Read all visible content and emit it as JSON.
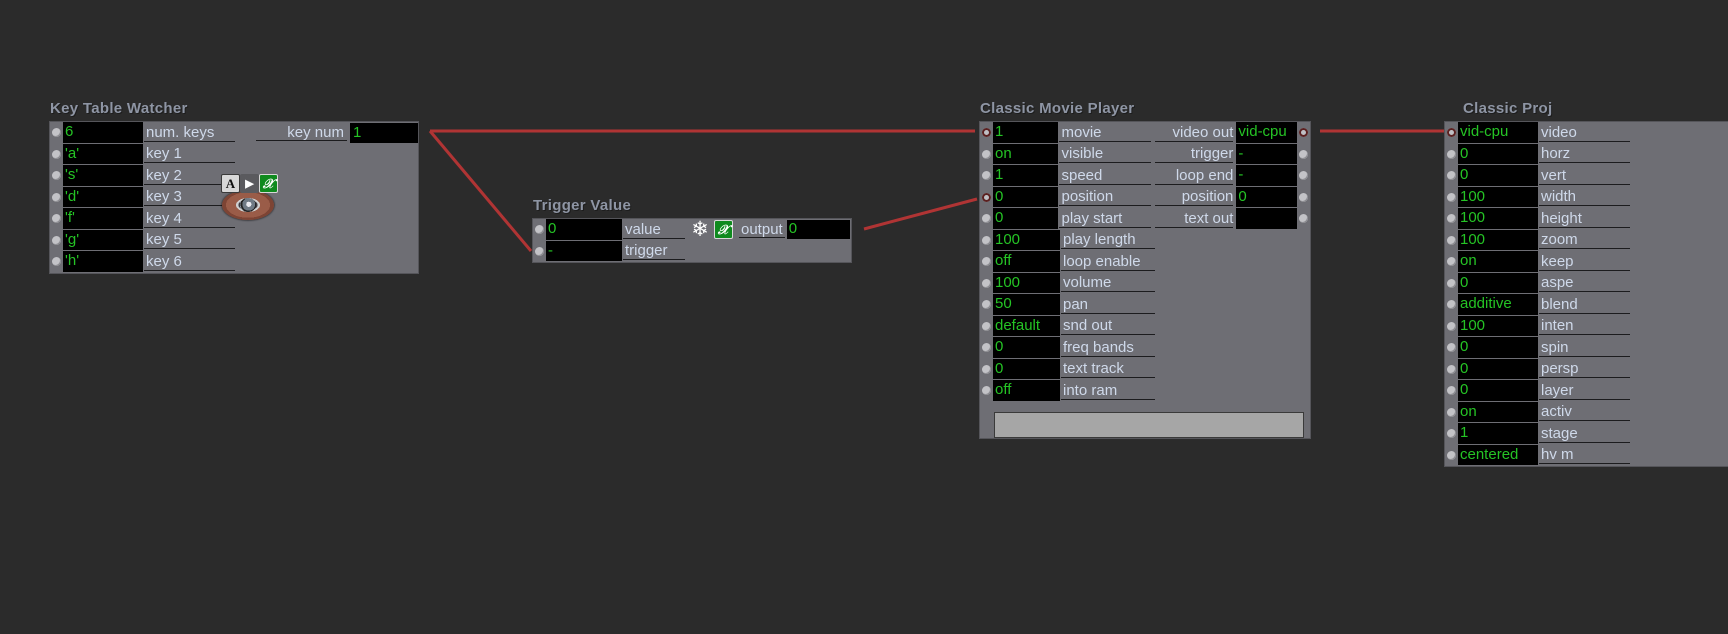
{
  "canvas": {
    "background": "#2b2b2b",
    "node_background": "#6e6e74",
    "value_text_color": "#25c425",
    "label_text_color": "#cfd9ea",
    "title_color": "#8e95a4",
    "wire_color": "#b03434"
  },
  "nodes": {
    "key_table_watcher": {
      "title": "Key Table Watcher",
      "output_label": "key num",
      "output_value": "1",
      "icons": [
        "letter-a-icon",
        "play-icon",
        "function-x-icon",
        "eye-icon"
      ],
      "rows": [
        {
          "value": "6",
          "label": "num. keys"
        },
        {
          "value": "'a'",
          "label": "key 1"
        },
        {
          "value": "'s'",
          "label": "key 2"
        },
        {
          "value": "'d'",
          "label": "key 3"
        },
        {
          "value": "'f'",
          "label": "key 4"
        },
        {
          "value": "'g'",
          "label": "key 5"
        },
        {
          "value": "'h'",
          "label": "key 6"
        }
      ]
    },
    "trigger_value": {
      "title": "Trigger Value",
      "output_label": "output",
      "output_value": "0",
      "icons": [
        "snowflake-icon",
        "function-x-icon"
      ],
      "rows": [
        {
          "value": "0",
          "label": "value"
        },
        {
          "value": "-",
          "label": "trigger"
        }
      ]
    },
    "classic_movie_player": {
      "title": "Classic Movie Player",
      "inputs": [
        {
          "value": "1",
          "label": "movie"
        },
        {
          "value": "on",
          "label": "visible"
        },
        {
          "value": "1",
          "label": "speed"
        },
        {
          "value": "0",
          "label": "position"
        },
        {
          "value": "0",
          "label": "play start"
        },
        {
          "value": "100",
          "label": "play length"
        },
        {
          "value": "off",
          "label": "loop enable"
        },
        {
          "value": "100",
          "label": "volume"
        },
        {
          "value": "50",
          "label": "pan"
        },
        {
          "value": "default",
          "label": "snd out"
        },
        {
          "value": "0",
          "label": "freq bands"
        },
        {
          "value": "0",
          "label": "text track"
        },
        {
          "value": "off",
          "label": "into ram"
        }
      ],
      "outputs": [
        {
          "label": "video out",
          "value": "vid-cpu"
        },
        {
          "label": "trigger",
          "value": "-"
        },
        {
          "label": "loop end",
          "value": "-"
        },
        {
          "label": "position",
          "value": "0"
        },
        {
          "label": "text out",
          "value": ""
        }
      ]
    },
    "classic_projector": {
      "title": "Classic Proj",
      "rows": [
        {
          "value": "vid-cpu",
          "label": "video"
        },
        {
          "value": "0",
          "label": "horz"
        },
        {
          "value": "0",
          "label": "vert"
        },
        {
          "value": "100",
          "label": "width"
        },
        {
          "value": "100",
          "label": "height"
        },
        {
          "value": "100",
          "label": "zoom"
        },
        {
          "value": "on",
          "label": "keep"
        },
        {
          "value": "0",
          "label": "aspe"
        },
        {
          "value": "additive",
          "label": "blend"
        },
        {
          "value": "100",
          "label": "inten"
        },
        {
          "value": "0",
          "label": "spin"
        },
        {
          "value": "0",
          "label": "persp"
        },
        {
          "value": "0",
          "label": "layer"
        },
        {
          "value": "on",
          "label": "activ"
        },
        {
          "value": "1",
          "label": "stage"
        },
        {
          "value": "centered",
          "label": "hv m"
        }
      ]
    }
  }
}
